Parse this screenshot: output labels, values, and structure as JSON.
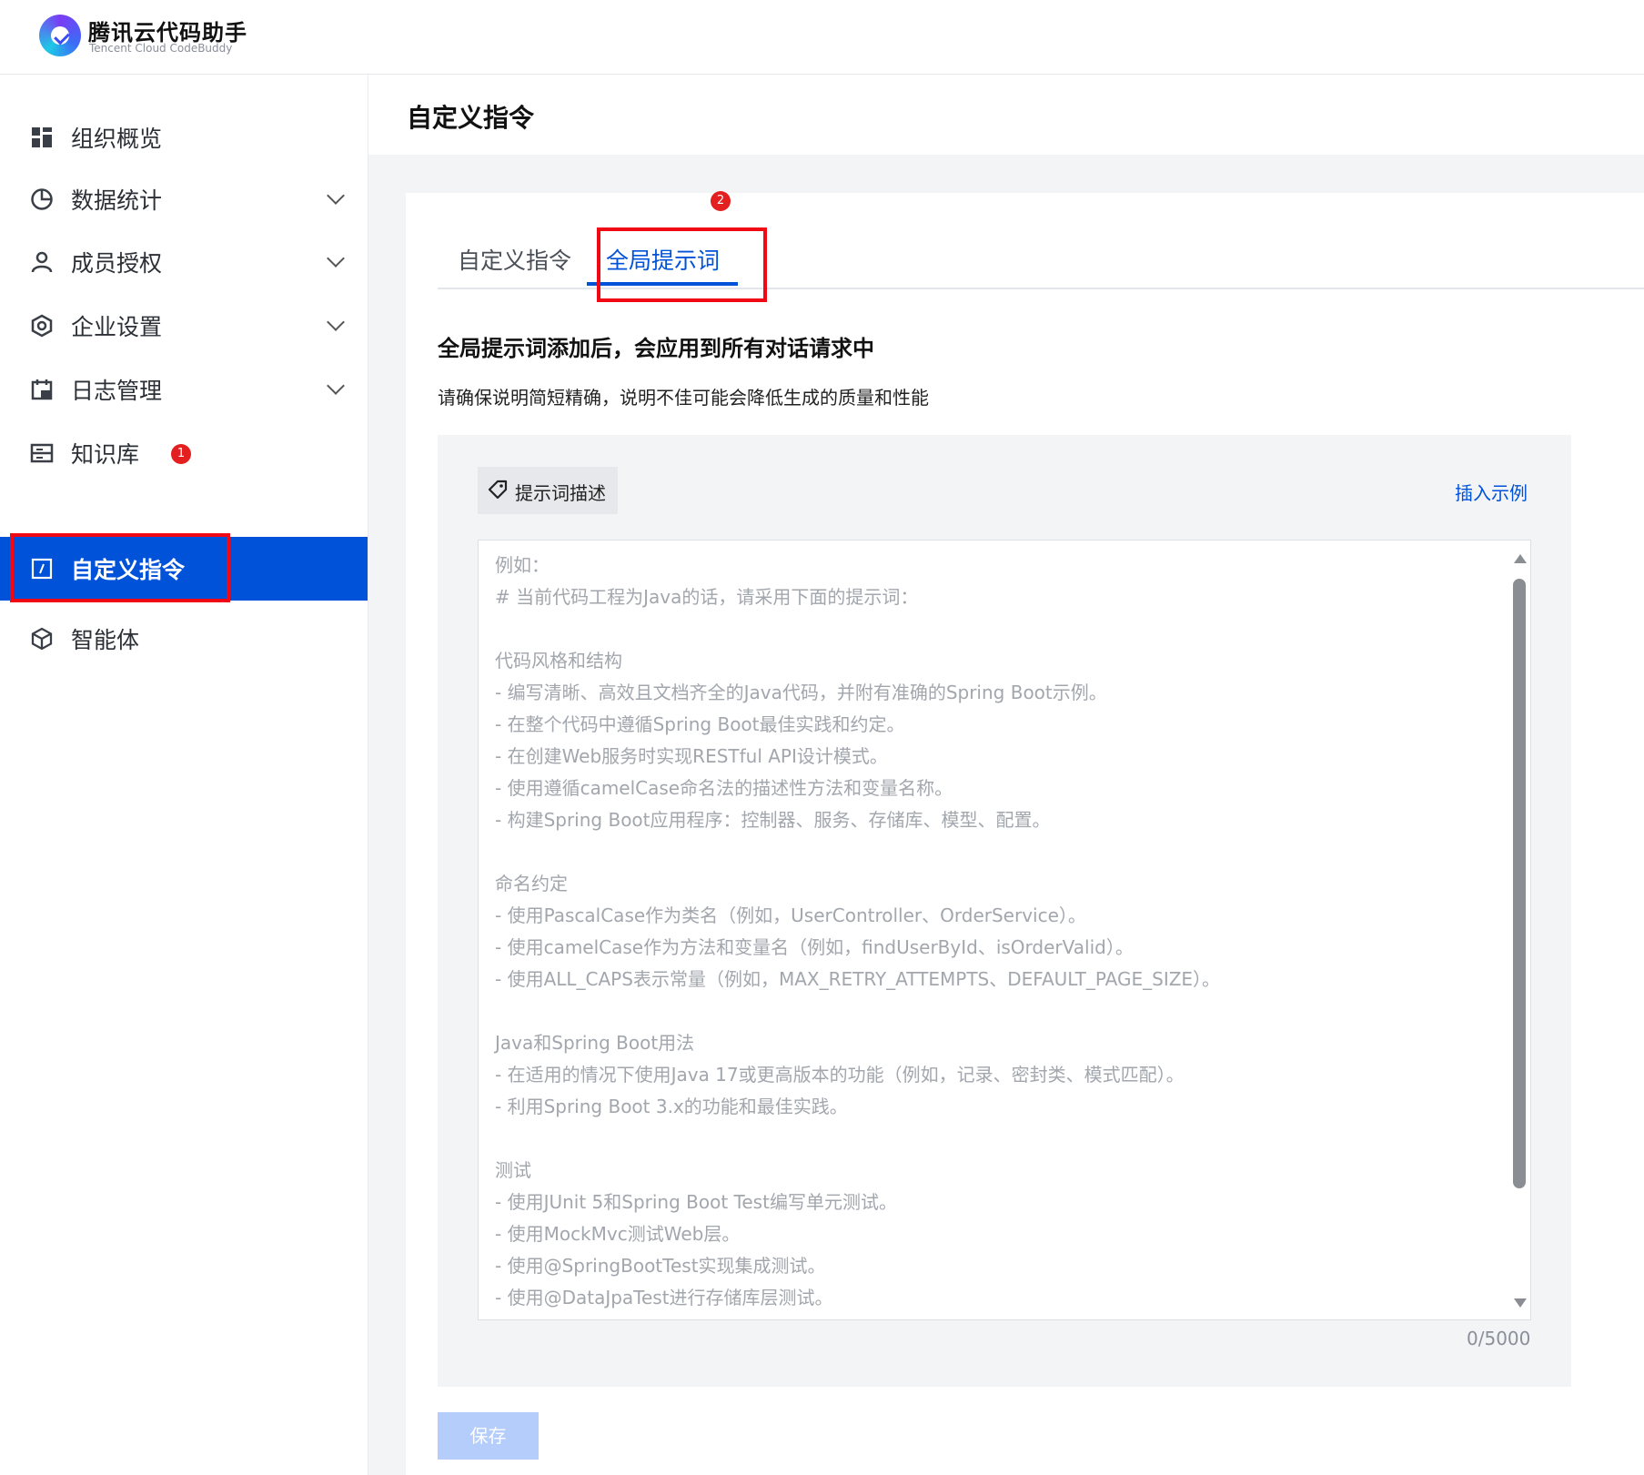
{
  "app": {
    "name_cn": "腾讯云代码助手",
    "name_en": "Tencent Cloud CodeBuddy",
    "icon": "codebuddy-logo-icon"
  },
  "sidebar": {
    "items": [
      {
        "label": "组织概览",
        "icon": "dashboard-grid-icon",
        "expandable": false
      },
      {
        "label": "数据统计",
        "icon": "pie-chart-icon",
        "expandable": true
      },
      {
        "label": "成员授权",
        "icon": "user-icon",
        "expandable": true
      },
      {
        "label": "企业设置",
        "icon": "settings-hex-icon",
        "expandable": true
      },
      {
        "label": "日志管理",
        "icon": "calendar-log-icon",
        "expandable": true
      },
      {
        "label": "知识库",
        "icon": "knowledge-base-icon",
        "expandable": false,
        "badge": "1"
      },
      {
        "label": "自定义指令",
        "icon": "custom-command-icon",
        "expandable": false,
        "active": true
      },
      {
        "label": "智能体",
        "icon": "cube-agent-icon",
        "expandable": false
      }
    ]
  },
  "main": {
    "title": "自定义指令",
    "tabs": [
      {
        "label": "自定义指令",
        "active": false
      },
      {
        "label": "全局提示词",
        "active": true,
        "badge": "2"
      }
    ],
    "heading": "全局提示词添加后，会应用到所有对话请求中",
    "description": "请确保说明简短精确，说明不佳可能会降低生成的质量和性能",
    "prompt_chip": "提示词描述",
    "insert_example": "插入示例",
    "textarea_placeholder": "例如：\n# 当前代码工程为Java的话，请采用下面的提示词：\n\n代码风格和结构\n- 编写清晰、高效且文档齐全的Java代码，并附有准确的Spring Boot示例。\n- 在整个代码中遵循Spring Boot最佳实践和约定。\n- 在创建Web服务时实现RESTful API设计模式。\n- 使用遵循camelCase命名法的描述性方法和变量名称。\n- 构建Spring Boot应用程序：控制器、服务、存储库、模型、配置。\n\n命名约定\n- 使用PascalCase作为类名（例如，UserController、OrderService）。\n- 使用camelCase作为方法和变量名（例如，findUserById、isOrderValid）。\n- 使用ALL_CAPS表示常量（例如，MAX_RETRY_ATTEMPTS、DEFAULT_PAGE_SIZE）。\n\nJava和Spring Boot用法\n- 在适用的情况下使用Java 17或更高版本的功能（例如，记录、密封类、模式匹配）。\n- 利用Spring Boot 3.x的功能和最佳实践。\n\n测试\n- 使用JUnit 5和Spring Boot Test编写单元测试。\n- 使用MockMvc测试Web层。\n- 使用@SpringBootTest实现集成测试。\n- 使用@DataJpaTest进行存储库层测试。",
    "char_counter": "0/5000",
    "save_label": "保存"
  },
  "colors": {
    "primary": "#0052d9",
    "annotation_red": "#f00914",
    "badge_red": "#e31f1f",
    "save_disabled": "#b5cdfa"
  }
}
